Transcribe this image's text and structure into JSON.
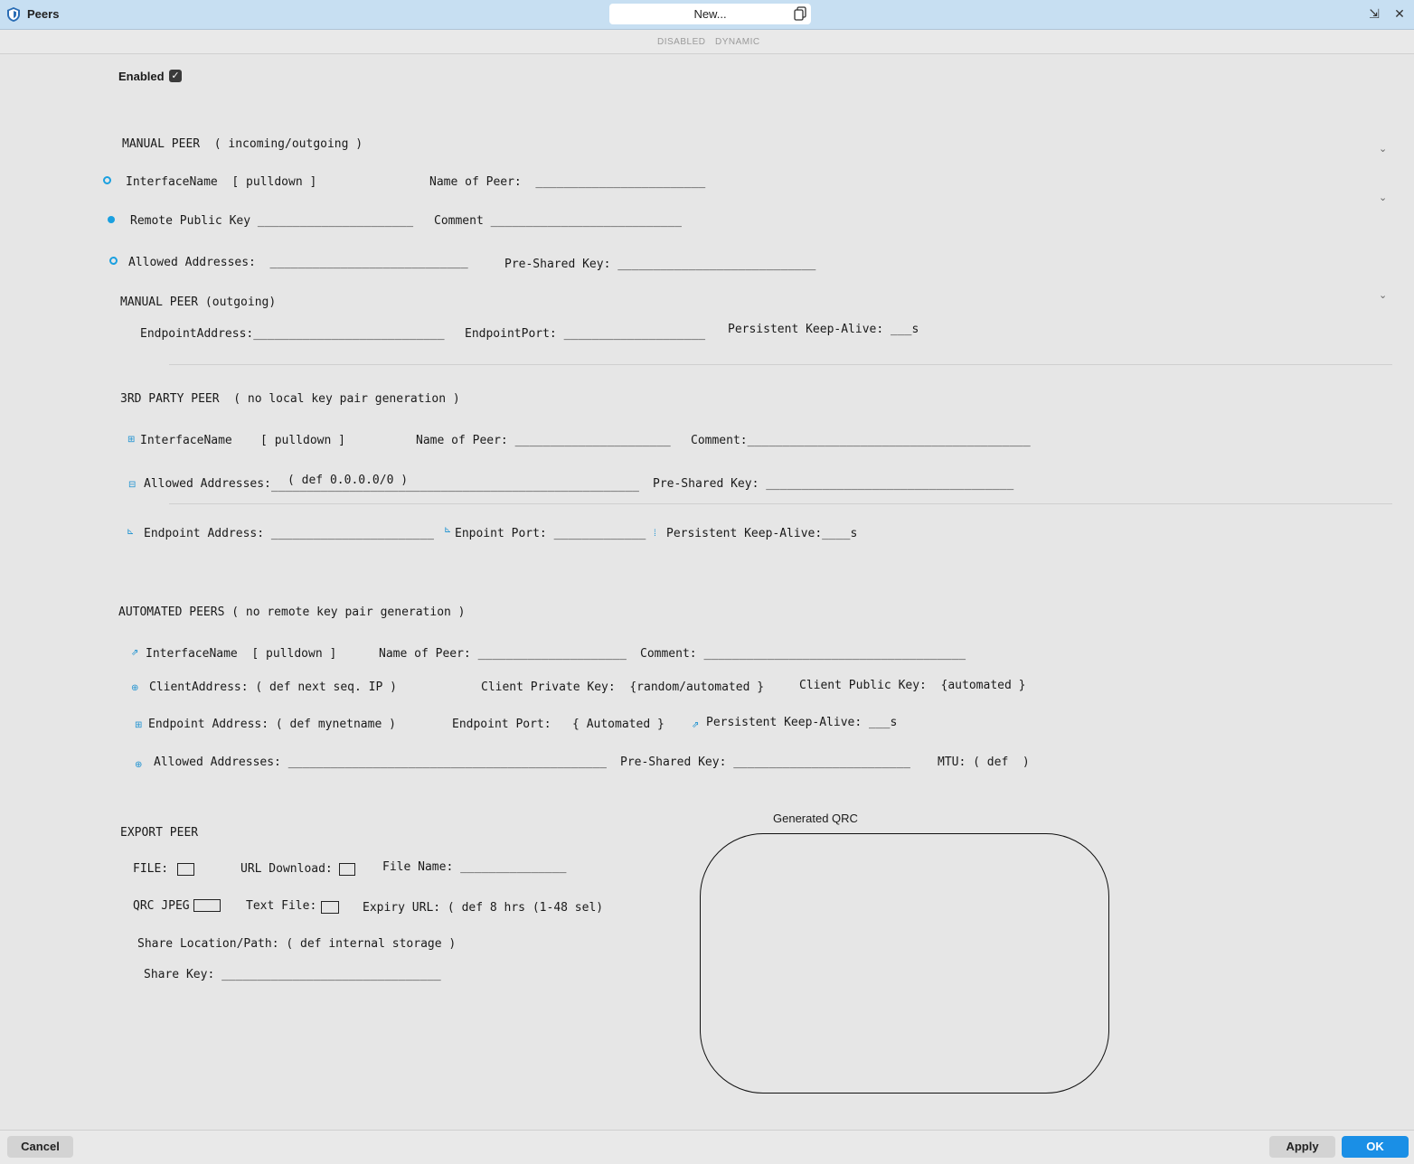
{
  "window": {
    "title": "Peers",
    "name_field": "New...",
    "pin_glyph": "⇲",
    "close_glyph": "✕"
  },
  "modes": [
    "DISABLED",
    "DYNAMIC"
  ],
  "enabled": {
    "label": "Enabled",
    "checked": true,
    "check_glyph": "✓"
  },
  "manual_peer": {
    "heading": "MANUAL PEER  ( incoming/outgoing )",
    "interface_name": "InterfaceName  [ pulldown ]",
    "name_of_peer": "Name of Peer:  ________________________",
    "remote_public_key": "Remote Public Key ______________________",
    "comment": "Comment ___________________________",
    "allowed_addresses": "Allowed Addresses:  ____________________________",
    "pre_shared_key": "Pre-Shared Key: ____________________________"
  },
  "manual_peer_outgoing": {
    "heading": "MANUAL PEER (outgoing)",
    "endpoint_address": "EndpointAddress:___________________________",
    "endpoint_port": "EndpointPort: ____________________",
    "keepalive": "Persistent Keep-Alive: ___s"
  },
  "third_party_peer": {
    "heading": "3RD PARTY PEER  ( no local key pair generation )",
    "interface_name": "InterfaceName    [ pulldown ]",
    "name_of_peer": "Name of Peer: ______________________",
    "comment": "Comment:________________________________________",
    "allowed_addresses_label": "Allowed Addresses:",
    "allowed_addresses_value": "( def 0.0.0.0/0 )",
    "allowed_addresses_line": "____________________________________________________",
    "pre_shared_key": "Pre-Shared Key: ___________________________________",
    "endpoint_address": "Endpoint Address: _______________________",
    "endpoint_port": "Enpoint Port: _____________",
    "keepalive": "Persistent Keep-Alive:____s"
  },
  "automated_peers": {
    "heading": "AUTOMATED PEERS ( no remote key pair generation )",
    "interface_name": "InterfaceName  [ pulldown ]",
    "name_of_peer": "Name of Peer: _____________________",
    "comment": "Comment: _____________________________________",
    "client_address": "ClientAddress: ( def next seq. IP )",
    "client_private_key": "Client Private Key:  {random/automated }",
    "client_public_key": "Client Public Key:  {automated }",
    "endpoint_address": "Endpoint Address: ( def mynetname )",
    "endpoint_port": "Endpoint Port:   { Automated }",
    "keepalive": "Persistent Keep-Alive: ___s",
    "allowed_addresses": "Allowed Addresses: _____________________________________________",
    "pre_shared_key": "Pre-Shared Key: _________________________",
    "mtu": "MTU: ( def  )"
  },
  "export_peer": {
    "heading": "EXPORT PEER",
    "file": "FILE:",
    "url_download": "URL Download:",
    "file_name": "File Name: _______________",
    "qrc_jpeg": "QRC JPEG",
    "text_file": "Text File:",
    "expiry_url": "Expiry URL: ( def 8 hrs (1-48 sel)",
    "share_location": "Share Location/Path: ( def internal storage )",
    "share_key": "Share Key: _______________________________"
  },
  "qrc": {
    "label": "Generated QRC"
  },
  "buttons": {
    "cancel": "Cancel",
    "apply": "Apply",
    "ok": "OK"
  },
  "colors": {
    "accent": "#1a8fe6",
    "titlebar": "#c7dff2",
    "background": "#e6e6e6"
  }
}
